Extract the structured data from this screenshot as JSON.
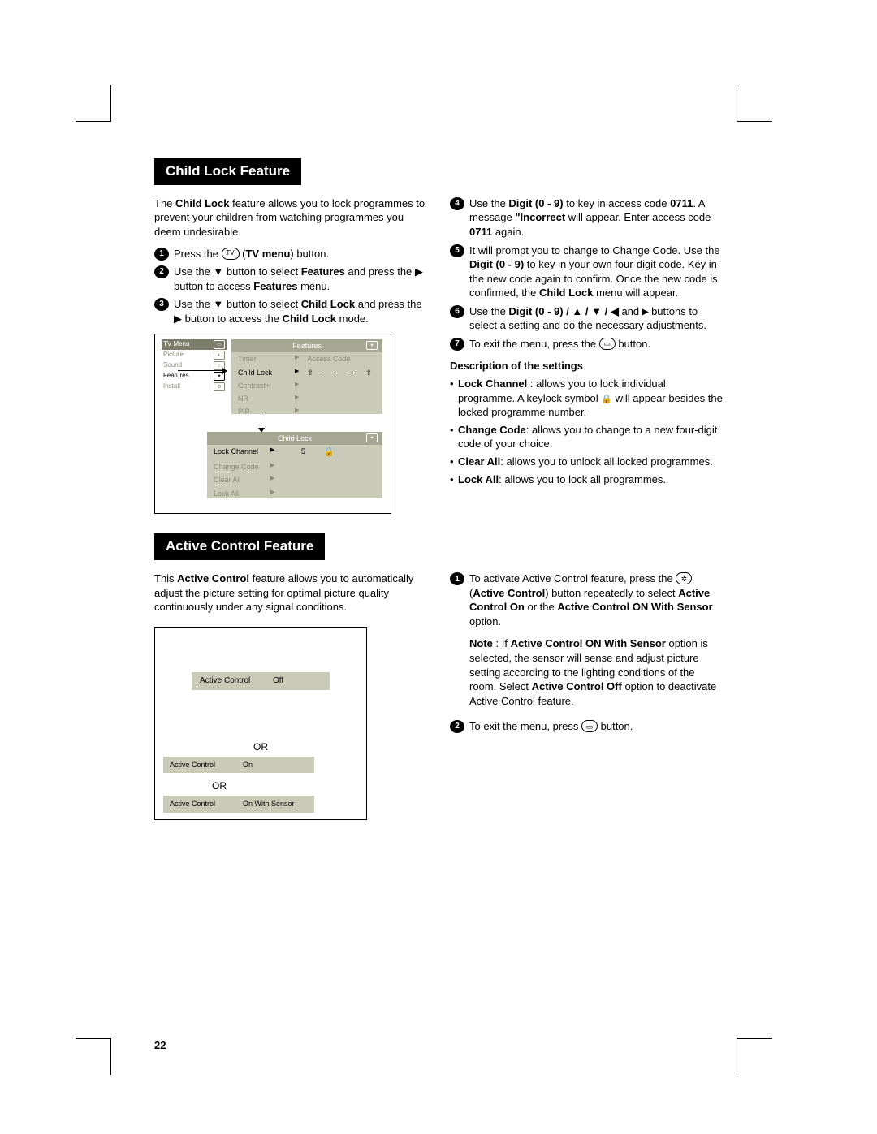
{
  "page_number": "22",
  "section1": {
    "title": "Child Lock Feature",
    "intro_pre": "The ",
    "intro_bold": "Child Lock",
    "intro_post": " feature allows you to lock programmes to prevent your children from watching programmes you deem undesirable.",
    "steps_left": {
      "s1_pre": "Press the ",
      "s1_icon": "TV",
      "s1_post_a": " (",
      "s1_post_b": "TV menu",
      "s1_post_c": ") button.",
      "s2_a": "Use the ▼ button to select ",
      "s2_b": "Features",
      "s2_c": " and press the ▶ button to access ",
      "s2_d": "Features",
      "s2_e": " menu.",
      "s3_a": "Use the ▼ button to select ",
      "s3_b": "Child Lock",
      "s3_c": " and press the ▶ button to access the ",
      "s3_d": "Child Lock",
      "s3_e": " mode."
    },
    "steps_right": {
      "s4_a": "Use the ",
      "s4_b": "Digit (0 - 9)",
      "s4_c": " to key in access code ",
      "s4_d": "0711",
      "s4_e": ". A message ",
      "s4_f": "\"Incorrect",
      "s4_g": " will appear. Enter access code ",
      "s4_h": "0711",
      "s4_i": " again.",
      "s5_a": "It will prompt you to change to Change Code. Use the ",
      "s5_b": "Digit (0 - 9)",
      "s5_c": " to key in your own four-digit code. Key in the new code again to confirm. Once the new code is confirmed, the ",
      "s5_d": "Child Lock",
      "s5_e": " menu will appear.",
      "s6_a": "Use the ",
      "s6_b": "Digit (0 - 9) / ▲ / ▼ / ◀",
      "s6_c": " and ",
      "s6_d": "▶",
      "s6_e": " buttons to select a setting and do the necessary adjustments.",
      "s7_a": "To exit the menu, press the ",
      "s7_b": " button."
    },
    "descr_head": "Description of the settings",
    "descr": {
      "d1_a": "Lock Channel",
      "d1_b": " : allows you to lock individual programme. A keylock symbol ",
      "d1_c": " will appear besides the locked programme number.",
      "d2_a": "Change Code",
      "d2_b": ": allows you to change to a new four-digit code of your choice.",
      "d3_a": "Clear All",
      "d3_b": ": allows you to unlock all locked programmes.",
      "d4_a": "Lock All",
      "d4_b": ": allows you to lock all programmes."
    },
    "diagram": {
      "main_menu": [
        "TV Menu",
        "Picture",
        "Sound",
        "Features",
        "Install"
      ],
      "feat_head": "Features",
      "feat_rows": [
        "Timer",
        "Child Lock",
        "Contrast+",
        "NR",
        "PIP"
      ],
      "feat_right": "Access Code",
      "cl_head": "Child Lock",
      "cl_rows": [
        "Lock Channel",
        "Change Code",
        "Clear All",
        "Lock All"
      ],
      "cl_value": "5"
    }
  },
  "section2": {
    "title": "Active Control Feature",
    "intro_pre": "This ",
    "intro_bold": "Active Control",
    "intro_post": " feature allows you to automatically adjust the picture setting for optimal picture quality continuously under any signal conditions.",
    "or": "OR",
    "strip_label": "Active Control",
    "strip_off": "Off",
    "strip_on": "On",
    "strip_sensor": "On With Sensor",
    "steps": {
      "s1_a": "To activate Active Control feature, press the ",
      "s1_b": " (",
      "s1_c": "Active Control",
      "s1_d": ") button repeatedly to select ",
      "s1_e": "Active Control On",
      "s1_f": " or the ",
      "s1_g": "Active Control ON With Sensor",
      "s1_h": " option.",
      "note_a": "Note",
      "note_b": " : If ",
      "note_c": "Active Control ON With Sensor",
      "note_d": " option is selected, the sensor will sense and adjust picture setting according to the lighting conditions of the room. Select ",
      "note_e": "Active Control Off",
      "note_f": " option to deactivate Active Control feature.",
      "s2_a": "To exit the menu, press ",
      "s2_b": " button."
    }
  }
}
